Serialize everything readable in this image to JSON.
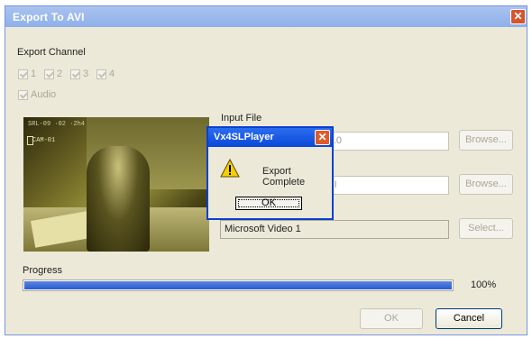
{
  "window": {
    "title": "Export To AVI",
    "close_glyph": "✕"
  },
  "channel": {
    "label": "Export Channel",
    "items": [
      {
        "label": "1",
        "checked": true
      },
      {
        "label": "2",
        "checked": true
      },
      {
        "label": "3",
        "checked": true
      },
      {
        "label": "4",
        "checked": true
      }
    ],
    "audio_label": "Audio"
  },
  "preview": {
    "hud_text": "SRL-09 ·02 ·2h4",
    "cam_text": "CAM-01"
  },
  "input_file": {
    "label": "Input File",
    "value": "ork\\Viewer\\VxSDK_2.6.1.0",
    "browse": "Browse..."
  },
  "output_file": {
    "value": "20090300\\CAPTURE.AVI",
    "browse": "Browse..."
  },
  "codec": {
    "value": "Microsoft Video 1",
    "select": "Select..."
  },
  "progress": {
    "label": "Progress",
    "value": 1.0,
    "text": "100%"
  },
  "buttons": {
    "ok": "OK",
    "cancel": "Cancel"
  },
  "dialog": {
    "title": "Vx4SLPlayer",
    "message": "Export Complete",
    "ok": "OK",
    "icon": "warning-icon"
  },
  "colors": {
    "accent": "#2a5bd1",
    "titlebar": "#8fb0ea",
    "dialog_titlebar": "#0a48d8"
  }
}
